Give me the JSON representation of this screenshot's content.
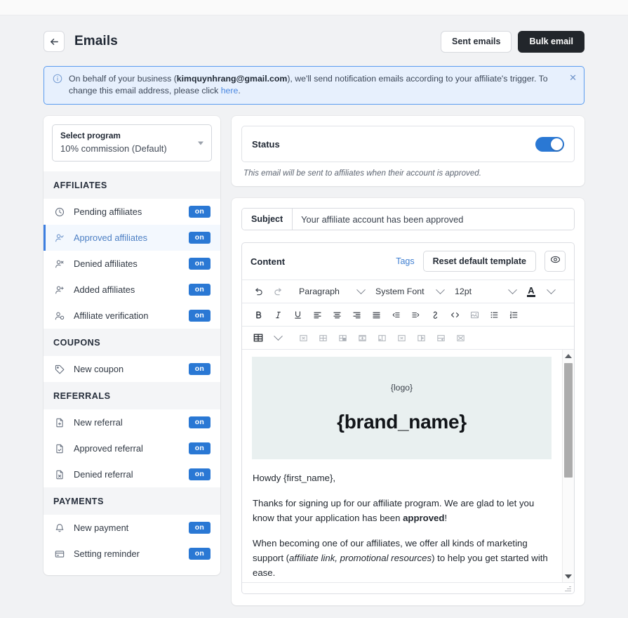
{
  "header": {
    "title": "Emails",
    "back_icon": "arrow-left-icon",
    "sent_emails_label": "Sent emails",
    "bulk_email_label": "Bulk email"
  },
  "banner": {
    "icon": "info-circle-icon",
    "text_before": "On behalf of your business (",
    "email": "kimquynhrang@gmail.com",
    "text_middle": "), we'll send notification emails according to your affiliate's trigger. To change this email address, please click ",
    "link": "here",
    "text_after": ".",
    "close_icon": "close-icon",
    "border_color": "#5b9cf0",
    "bg_color": "#e7f0fd"
  },
  "sidebar": {
    "select_program": {
      "label": "Select program",
      "value": "10% commission (Default)",
      "caret_icon": "caret-down-icon"
    },
    "groups": [
      {
        "title": "AFFILIATES",
        "items": [
          {
            "label": "Pending affiliates",
            "icon": "clock-icon",
            "toggle": "on",
            "active": false
          },
          {
            "label": "Approved affiliates",
            "icon": "user-check-icon",
            "toggle": "on",
            "active": true
          },
          {
            "label": "Denied affiliates",
            "icon": "user-x-icon",
            "toggle": "on",
            "active": false
          },
          {
            "label": "Added affiliates",
            "icon": "user-plus-icon",
            "toggle": "on",
            "active": false
          },
          {
            "label": "Affiliate verification",
            "icon": "user-badge-icon",
            "toggle": "on",
            "active": false
          }
        ]
      },
      {
        "title": "COUPONS",
        "items": [
          {
            "label": "New coupon",
            "icon": "tag-icon",
            "toggle": "on",
            "active": false
          }
        ]
      },
      {
        "title": "REFERRALS",
        "items": [
          {
            "label": "New referral",
            "icon": "file-plus-icon",
            "toggle": "on",
            "active": false
          },
          {
            "label": "Approved referral",
            "icon": "file-check-icon",
            "toggle": "on",
            "active": false
          },
          {
            "label": "Denied referral",
            "icon": "file-x-icon",
            "toggle": "on",
            "active": false
          }
        ]
      },
      {
        "title": "PAYMENTS",
        "items": [
          {
            "label": "New payment",
            "icon": "bell-icon",
            "toggle": "on",
            "active": false
          },
          {
            "label": "Setting reminder",
            "icon": "credit-card-icon",
            "toggle": "on",
            "active": false
          }
        ]
      }
    ],
    "pill_color": "#2a78d4",
    "active_accent": "#3c7ee0"
  },
  "status": {
    "label": "Status",
    "toggle_on": true,
    "note": "This email will be sent to affiliates when their account is approved.",
    "toggle_color": "#2a78d4"
  },
  "editor": {
    "subject_label": "Subject",
    "subject_value": "Your affiliate account has been approved",
    "subject_placeholder": "Subject",
    "content_label": "Content",
    "tags_label": "Tags",
    "reset_label": "Reset default template",
    "preview_icon": "eye-icon",
    "toolbar_row1": [
      {
        "icon": "undo-icon",
        "type": "button"
      },
      {
        "icon": "redo-icon",
        "type": "button"
      },
      {
        "icon": "block-format-select",
        "type": "select",
        "value": "Paragraph"
      },
      {
        "icon": "font-family-select",
        "type": "select",
        "value": "System Font"
      },
      {
        "icon": "font-size-select",
        "type": "select",
        "value": "12pt"
      },
      {
        "icon": "text-color-icon",
        "type": "split"
      }
    ],
    "toolbar_row2": [
      "bold-icon",
      "italic-icon",
      "underline-icon",
      "align-left-icon",
      "align-center-icon",
      "align-right-icon",
      "align-justify-icon",
      "outdent-icon",
      "indent-icon",
      "link-icon",
      "source-code-icon",
      "image-icon",
      "bullet-list-icon",
      "numbered-list-icon"
    ],
    "toolbar_row3": [
      "table-icon",
      "table-dropdown-caret",
      "table-delete-icon",
      "table-properties-icon",
      "table-cell-properties-icon",
      "table-insert-row-icon",
      "table-insert-column-icon",
      "table-delete-row-icon",
      "table-delete-column-icon",
      "table-merge-cells-icon",
      "table-split-cell-icon"
    ]
  },
  "preview": {
    "logo_token": "{logo}",
    "brand_name": "{brand_name}",
    "brand_bg": "#e9f0f0",
    "paragraphs": [
      {
        "parts": [
          {
            "t": "Howdy {first_name},",
            "s": "normal"
          }
        ]
      },
      {
        "parts": [
          {
            "t": "Thanks for signing up for our affiliate program. We are glad to let you know that your application has been ",
            "s": "normal"
          },
          {
            "t": "approved",
            "s": "bold"
          },
          {
            "t": "!",
            "s": "normal"
          }
        ]
      },
      {
        "parts": [
          {
            "t": "When becoming one of our affiliates, we offer all kinds of marketing support (",
            "s": "normal"
          },
          {
            "t": "affiliate link, promotional resources",
            "s": "italic"
          },
          {
            "t": ") to help you get started with ease.",
            "s": "normal"
          }
        ]
      }
    ],
    "scrollbar": {
      "up_icon": "scroll-up-arrow-icon",
      "down_icon": "scroll-down-arrow-icon"
    },
    "resize_icon": "resize-handle-icon"
  }
}
